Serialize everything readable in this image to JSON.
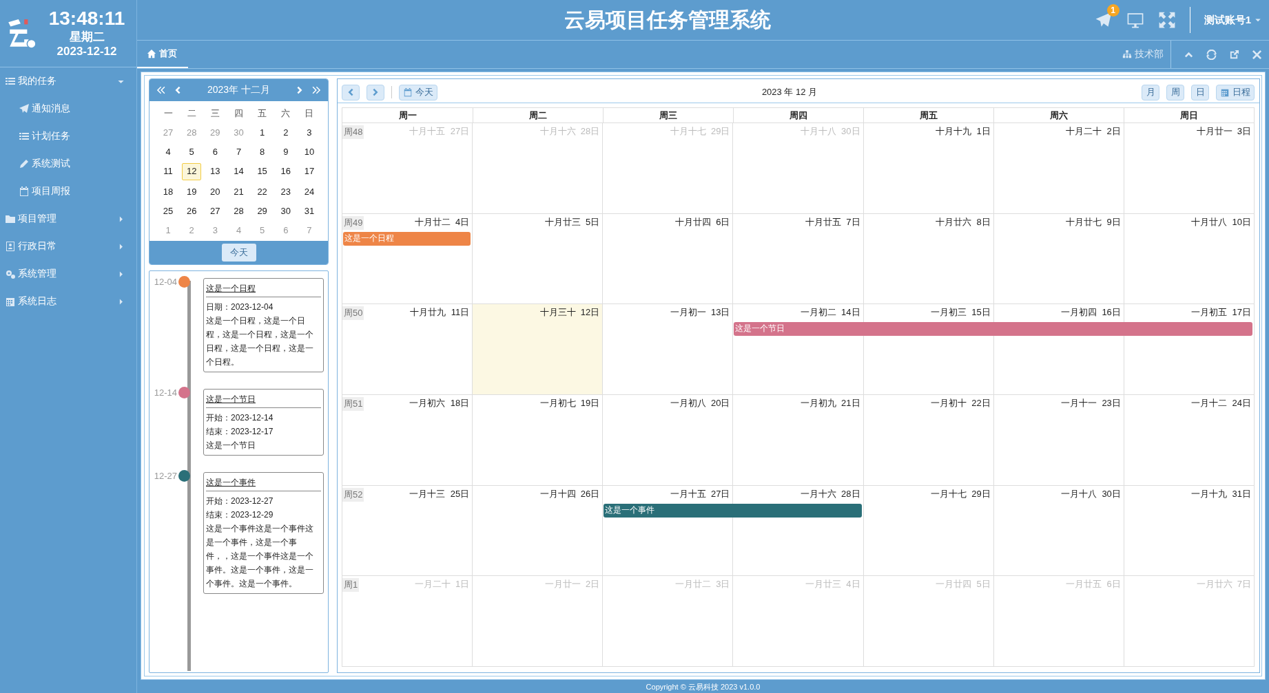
{
  "clock": {
    "time": "13:48:11",
    "weekday": "星期二",
    "date": "2023-12-12"
  },
  "header": {
    "title": "云易项目任务管理系统",
    "badge": "1",
    "user": "测试账号1"
  },
  "sidebar": {
    "items": [
      {
        "label": "我的任务",
        "expanded": true,
        "children": [
          {
            "label": "通知消息"
          },
          {
            "label": "计划任务"
          },
          {
            "label": "系统测试"
          },
          {
            "label": "项目周报"
          }
        ]
      },
      {
        "label": "项目管理",
        "expanded": false
      },
      {
        "label": "行政日常",
        "expanded": false
      },
      {
        "label": "系统管理",
        "expanded": false
      },
      {
        "label": "系统日志",
        "expanded": false
      }
    ]
  },
  "tabs": [
    {
      "label": "首页",
      "selected": true
    }
  ],
  "department": "技术部",
  "mini_calendar": {
    "title": "2023年 十二月",
    "weekdays": [
      "一",
      "二",
      "三",
      "四",
      "五",
      "六",
      "日"
    ],
    "weeks": [
      [
        {
          "d": "27",
          "other_month": true,
          "today": false
        },
        {
          "d": "28",
          "other_month": true,
          "today": false
        },
        {
          "d": "29",
          "other_month": true,
          "today": false
        },
        {
          "d": "30",
          "other_month": true,
          "today": false
        },
        {
          "d": "1",
          "other_month": false,
          "today": false
        },
        {
          "d": "2",
          "other_month": false,
          "today": false
        },
        {
          "d": "3",
          "other_month": false,
          "today": false
        }
      ],
      [
        {
          "d": "4",
          "other_month": false,
          "today": false
        },
        {
          "d": "5",
          "other_month": false,
          "today": false
        },
        {
          "d": "6",
          "other_month": false,
          "today": false
        },
        {
          "d": "7",
          "other_month": false,
          "today": false
        },
        {
          "d": "8",
          "other_month": false,
          "today": false
        },
        {
          "d": "9",
          "other_month": false,
          "today": false
        },
        {
          "d": "10",
          "other_month": false,
          "today": false
        }
      ],
      [
        {
          "d": "11",
          "other_month": false,
          "today": false
        },
        {
          "d": "12",
          "other_month": false,
          "today": true
        },
        {
          "d": "13",
          "other_month": false,
          "today": false
        },
        {
          "d": "14",
          "other_month": false,
          "today": false
        },
        {
          "d": "15",
          "other_month": false,
          "today": false
        },
        {
          "d": "16",
          "other_month": false,
          "today": false
        },
        {
          "d": "17",
          "other_month": false,
          "today": false
        }
      ],
      [
        {
          "d": "18",
          "other_month": false,
          "today": false
        },
        {
          "d": "19",
          "other_month": false,
          "today": false
        },
        {
          "d": "20",
          "other_month": false,
          "today": false
        },
        {
          "d": "21",
          "other_month": false,
          "today": false
        },
        {
          "d": "22",
          "other_month": false,
          "today": false
        },
        {
          "d": "23",
          "other_month": false,
          "today": false
        },
        {
          "d": "24",
          "other_month": false,
          "today": false
        }
      ],
      [
        {
          "d": "25",
          "other_month": false,
          "today": false
        },
        {
          "d": "26",
          "other_month": false,
          "today": false
        },
        {
          "d": "27",
          "other_month": false,
          "today": false
        },
        {
          "d": "28",
          "other_month": false,
          "today": false
        },
        {
          "d": "29",
          "other_month": false,
          "today": false
        },
        {
          "d": "30",
          "other_month": false,
          "today": false
        },
        {
          "d": "31",
          "other_month": false,
          "today": false
        }
      ],
      [
        {
          "d": "1",
          "other_month": true,
          "today": false
        },
        {
          "d": "2",
          "other_month": true,
          "today": false
        },
        {
          "d": "3",
          "other_month": true,
          "today": false
        },
        {
          "d": "4",
          "other_month": true,
          "today": false
        },
        {
          "d": "5",
          "other_month": true,
          "today": false
        },
        {
          "d": "6",
          "other_month": true,
          "today": false
        },
        {
          "d": "7",
          "other_month": true,
          "today": false
        }
      ]
    ],
    "today_button": "今天"
  },
  "timeline": [
    {
      "date": "12-04",
      "color": "#ee8547",
      "title": "这是一个日程",
      "lines": [
        "日期：2023-12-04",
        "这是一个日程，这是一个日程，这是一个日程，这是一个日程，这是一个日程，这是一个日程。"
      ]
    },
    {
      "date": "12-14",
      "color": "#d4738b",
      "title": "这是一个节日",
      "lines": [
        "开始：2023-12-14",
        "结束：2023-12-17",
        "这是一个节日"
      ]
    },
    {
      "date": "12-27",
      "color": "#2a6f78",
      "title": "这是一个事件",
      "lines": [
        "开始：2023-12-27",
        "结束：2023-12-29",
        "这是一个事件这是一个事件这是一个事件，这是一个事件，，这是一个事件这是一个事件。这是一个事件，这是一个事件。这是一个事件。"
      ]
    }
  ],
  "calendar": {
    "today_button": "今天",
    "title": "2023 年 12 月",
    "views": [
      "月",
      "周",
      "日",
      "日程"
    ],
    "weekdays": [
      "周一",
      "周二",
      "周三",
      "周四",
      "周五",
      "周六",
      "周日"
    ],
    "weeks": [
      {
        "label": "周48",
        "days": [
          {
            "lunar": "十月十五",
            "day": "27日",
            "other_month": true,
            "today": false
          },
          {
            "lunar": "十月十六",
            "day": "28日",
            "other_month": true,
            "today": false
          },
          {
            "lunar": "十月十七",
            "day": "29日",
            "other_month": true,
            "today": false
          },
          {
            "lunar": "十月十八",
            "day": "30日",
            "other_month": true,
            "today": false
          },
          {
            "lunar": "十月十九",
            "day": "1日",
            "other_month": false,
            "today": false
          },
          {
            "lunar": "十月二十",
            "day": "2日",
            "other_month": false,
            "today": false
          },
          {
            "lunar": "十月廿一",
            "day": "3日",
            "other_month": false,
            "today": false
          }
        ]
      },
      {
        "label": "周49",
        "days": [
          {
            "lunar": "十月廿二",
            "day": "4日",
            "other_month": false,
            "today": false,
            "event": {
              "title": "这是一个日程",
              "color": "#ee8547"
            }
          },
          {
            "lunar": "十月廿三",
            "day": "5日",
            "other_month": false,
            "today": false
          },
          {
            "lunar": "十月廿四",
            "day": "6日",
            "other_month": false,
            "today": false
          },
          {
            "lunar": "十月廿五",
            "day": "7日",
            "other_month": false,
            "today": false
          },
          {
            "lunar": "十月廿六",
            "day": "8日",
            "other_month": false,
            "today": false
          },
          {
            "lunar": "十月廿七",
            "day": "9日",
            "other_month": false,
            "today": false
          },
          {
            "lunar": "十月廿八",
            "day": "10日",
            "other_month": false,
            "today": false
          }
        ]
      },
      {
        "label": "周50",
        "days": [
          {
            "lunar": "十月廿九",
            "day": "11日",
            "other_month": false,
            "today": false
          },
          {
            "lunar": "十月三十",
            "day": "12日",
            "other_month": false,
            "today": true
          },
          {
            "lunar": "一月初一",
            "day": "13日",
            "other_month": false,
            "today": false
          },
          {
            "lunar": "一月初二",
            "day": "14日",
            "other_month": false,
            "today": false,
            "event": {
              "title": "这是一个节日",
              "color": "#d4738b"
            }
          },
          {
            "lunar": "一月初三",
            "day": "15日",
            "other_month": false,
            "today": false,
            "continues": true
          },
          {
            "lunar": "一月初四",
            "day": "16日",
            "other_month": false,
            "today": false,
            "continues": true
          },
          {
            "lunar": "一月初五",
            "day": "17日",
            "other_month": false,
            "today": false,
            "continues": true
          }
        ]
      },
      {
        "label": "周51",
        "days": [
          {
            "lunar": "一月初六",
            "day": "18日",
            "other_month": false,
            "today": false
          },
          {
            "lunar": "一月初七",
            "day": "19日",
            "other_month": false,
            "today": false
          },
          {
            "lunar": "一月初八",
            "day": "20日",
            "other_month": false,
            "today": false
          },
          {
            "lunar": "一月初九",
            "day": "21日",
            "other_month": false,
            "today": false
          },
          {
            "lunar": "一月初十",
            "day": "22日",
            "other_month": false,
            "today": false
          },
          {
            "lunar": "一月十一",
            "day": "23日",
            "other_month": false,
            "today": false
          },
          {
            "lunar": "一月十二",
            "day": "24日",
            "other_month": false,
            "today": false
          }
        ]
      },
      {
        "label": "周52",
        "days": [
          {
            "lunar": "一月十三",
            "day": "25日",
            "other_month": false,
            "today": false
          },
          {
            "lunar": "一月十四",
            "day": "26日",
            "other_month": false,
            "today": false
          },
          {
            "lunar": "一月十五",
            "day": "27日",
            "other_month": false,
            "today": false,
            "event": {
              "title": "这是一个事件",
              "color": "#2a6f78"
            }
          },
          {
            "lunar": "一月十六",
            "day": "28日",
            "other_month": false,
            "today": false,
            "continues": true
          },
          {
            "lunar": "一月十七",
            "day": "29日",
            "other_month": false,
            "today": false
          },
          {
            "lunar": "一月十八",
            "day": "30日",
            "other_month": false,
            "today": false
          },
          {
            "lunar": "一月十九",
            "day": "31日",
            "other_month": false,
            "today": false
          }
        ]
      },
      {
        "label": "周1",
        "days": [
          {
            "lunar": "一月二十",
            "day": "1日",
            "other_month": true,
            "today": false
          },
          {
            "lunar": "一月廿一",
            "day": "2日",
            "other_month": true,
            "today": false
          },
          {
            "lunar": "一月廿二",
            "day": "3日",
            "other_month": true,
            "today": false
          },
          {
            "lunar": "一月廿三",
            "day": "4日",
            "other_month": true,
            "today": false
          },
          {
            "lunar": "一月廿四",
            "day": "5日",
            "other_month": true,
            "today": false
          },
          {
            "lunar": "一月廿五",
            "day": "6日",
            "other_month": true,
            "today": false
          },
          {
            "lunar": "一月廿六",
            "day": "7日",
            "other_month": true,
            "today": false
          }
        ]
      }
    ]
  },
  "footer": "Copyright © 云易科技 2023 v1.0.0"
}
